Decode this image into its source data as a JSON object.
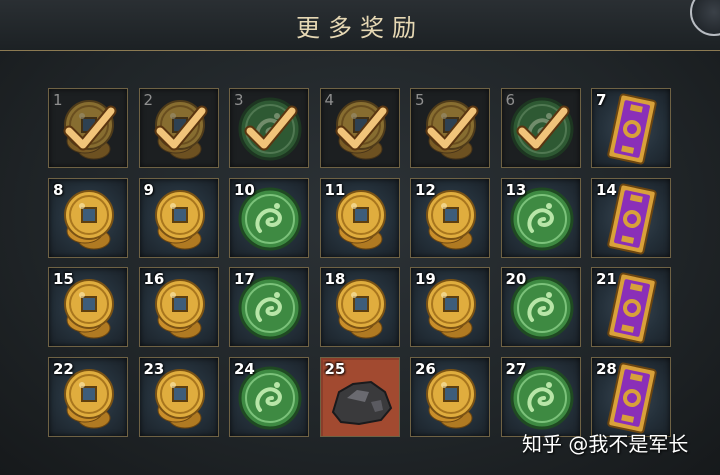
{
  "header": {
    "title": "更多奖励"
  },
  "colors": {
    "gold": "#d8a73a",
    "jade": "#3c8a3e",
    "card_purple": "#8a2fb8",
    "check": "#f1c47a"
  },
  "rewards": [
    {
      "number": "1",
      "item": "gold-coin",
      "claimed": true
    },
    {
      "number": "2",
      "item": "gold-coin",
      "claimed": true
    },
    {
      "number": "3",
      "item": "jade-token",
      "claimed": true
    },
    {
      "number": "4",
      "item": "gold-coin",
      "claimed": true
    },
    {
      "number": "5",
      "item": "gold-coin",
      "claimed": true
    },
    {
      "number": "6",
      "item": "jade-token",
      "claimed": true
    },
    {
      "number": "7",
      "item": "card",
      "claimed": false
    },
    {
      "number": "8",
      "item": "gold-coin",
      "claimed": false
    },
    {
      "number": "9",
      "item": "gold-coin",
      "claimed": false
    },
    {
      "number": "10",
      "item": "jade-token",
      "claimed": false
    },
    {
      "number": "11",
      "item": "gold-coin",
      "claimed": false
    },
    {
      "number": "12",
      "item": "gold-coin",
      "claimed": false
    },
    {
      "number": "13",
      "item": "jade-token",
      "claimed": false
    },
    {
      "number": "14",
      "item": "card",
      "claimed": false
    },
    {
      "number": "15",
      "item": "gold-coin",
      "claimed": false
    },
    {
      "number": "16",
      "item": "gold-coin",
      "claimed": false
    },
    {
      "number": "17",
      "item": "jade-token",
      "claimed": false
    },
    {
      "number": "18",
      "item": "gold-coin",
      "claimed": false
    },
    {
      "number": "19",
      "item": "gold-coin",
      "claimed": false
    },
    {
      "number": "20",
      "item": "jade-token",
      "claimed": false
    },
    {
      "number": "21",
      "item": "card",
      "claimed": false
    },
    {
      "number": "22",
      "item": "gold-coin",
      "claimed": false
    },
    {
      "number": "23",
      "item": "gold-coin",
      "claimed": false
    },
    {
      "number": "24",
      "item": "jade-token",
      "claimed": false
    },
    {
      "number": "25",
      "item": "iron-ore",
      "claimed": false
    },
    {
      "number": "26",
      "item": "gold-coin",
      "claimed": false
    },
    {
      "number": "27",
      "item": "jade-token",
      "claimed": false
    },
    {
      "number": "28",
      "item": "card",
      "claimed": false
    }
  ],
  "watermark": "知乎 @我不是军长"
}
